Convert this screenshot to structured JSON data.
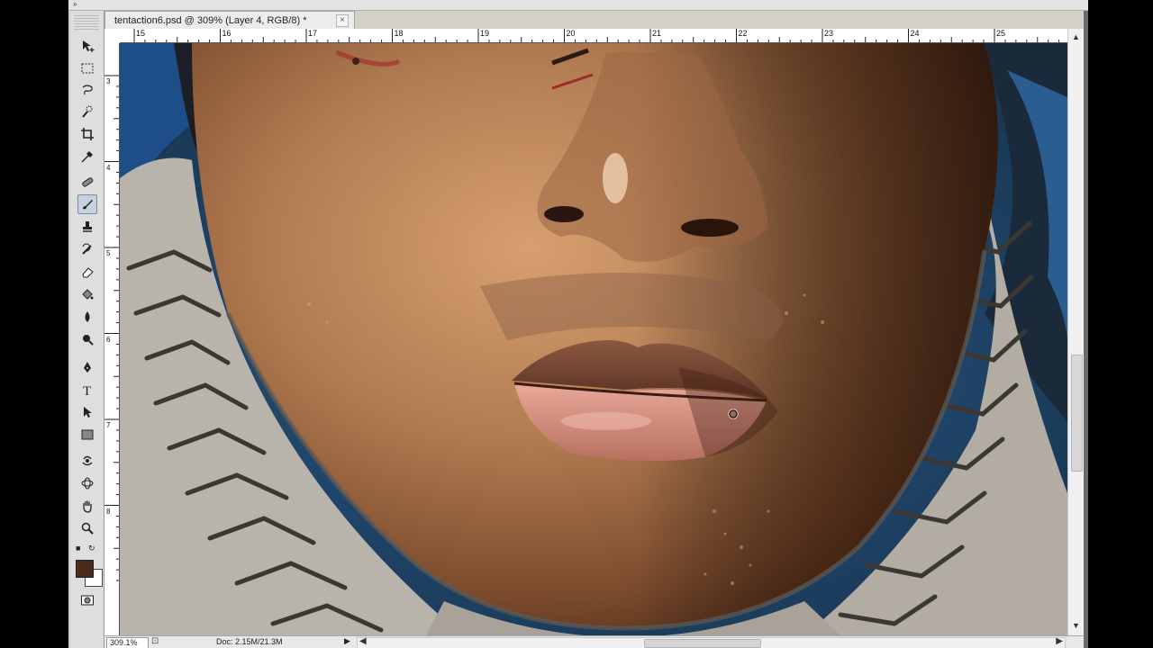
{
  "document": {
    "tab_title": "tentaction6.psd @ 309% (Layer 4, RGB/8) *",
    "close_glyph": "×"
  },
  "rulers": {
    "horizontal": [
      "15",
      "16",
      "17",
      "18",
      "19",
      "20",
      "21",
      "22",
      "23",
      "24",
      "25"
    ],
    "vertical": [
      "3",
      "4",
      "5",
      "6",
      "7",
      "8"
    ]
  },
  "status": {
    "zoom": "309.1%",
    "doc_info": "Doc: 2.15M/21.3M"
  },
  "colors": {
    "foreground": "#4a2a1a",
    "background": "#ffffff"
  },
  "tools": [
    {
      "name": "move-tool-icon"
    },
    {
      "name": "marquee-tool-icon"
    },
    {
      "name": "lasso-tool-icon"
    },
    {
      "name": "quick-select-tool-icon"
    },
    {
      "name": "crop-tool-icon"
    },
    {
      "name": "eyedropper-tool-icon"
    },
    {
      "name": "healing-brush-tool-icon"
    },
    {
      "name": "brush-tool-icon"
    },
    {
      "name": "clone-stamp-tool-icon"
    },
    {
      "name": "history-brush-tool-icon"
    },
    {
      "name": "eraser-tool-icon"
    },
    {
      "name": "paint-bucket-tool-icon"
    },
    {
      "name": "blur-tool-icon"
    },
    {
      "name": "dodge-tool-icon"
    },
    {
      "name": "pen-tool-icon"
    },
    {
      "name": "type-tool-icon"
    },
    {
      "name": "path-select-tool-icon"
    },
    {
      "name": "rectangle-tool-icon"
    },
    {
      "name": "3d-rotate-tool-icon"
    },
    {
      "name": "3d-orbit-tool-icon"
    },
    {
      "name": "hand-tool-icon"
    },
    {
      "name": "zoom-tool-icon"
    }
  ],
  "active_tool": "brush-tool-icon"
}
